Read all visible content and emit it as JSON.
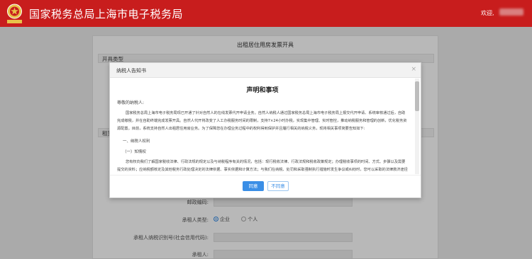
{
  "header": {
    "title": "国家税务总局上海市电子税务局",
    "welcome": "欢迎,",
    "emblem_text": "中国税务"
  },
  "page": {
    "title": "出租居住用房发票开具",
    "section_issue_type": "开具类型",
    "section_rent": "租赁"
  },
  "form": {
    "postal_code_label": "邮政编码:",
    "lessee_type_label": "承租人类型:",
    "lessee_type_options": [
      "企业",
      "个人"
    ],
    "lessee_type_selected": "企业",
    "lessee_tax_id_label": "承租人纳税识别号(社会信用代码):",
    "lessee_label": "承租人:"
  },
  "modal": {
    "title": "纳税人告知书",
    "doc_title": "声明和事项",
    "greeting": "尊敬的纳税人:",
    "paragraph1": "国家税务总局上海市电子税务局现已开通了针对自然人的在线发票代开申请业务。自然人纳税人通过国家税务总局上海市电子税务局上报交代开申请、系统审核通过后，自助完成缴税，并在自助终端完成发票开具。自然人代开将改变了人工办税服务时间的限制，支持7×24小时办税，实现集中管理、实时管控，推动纳税服务和管理的创新，优化税务资源配置。目前，系统支持自然人出租居住用房业务。为了保障您在办理业务过程中的权利得到保护并且履行相关的纳税义务，现将相关事项简要告知如下:",
    "heading1": "一、纳税人权利",
    "heading1_1": "（一）知情权",
    "paragraph2": "您有权向我们了解国家税收法律、行政法规的规定以及与纳税程序有关的情况，包括：现行税收法律、行政法规和税收政策规定；办理税收事项的时间、方式、步骤以及需要提交的资料；应纳税额核定及其他税务行政处理决定的法律依据、事实依据和计算方法；与我们在纳税、处罚和采取强制执行措施时发生争议或纠纷时，您可以采取的法律救济途径及需要满足的条件。",
    "agree_label": "同意",
    "disagree_label": "不同意"
  }
}
